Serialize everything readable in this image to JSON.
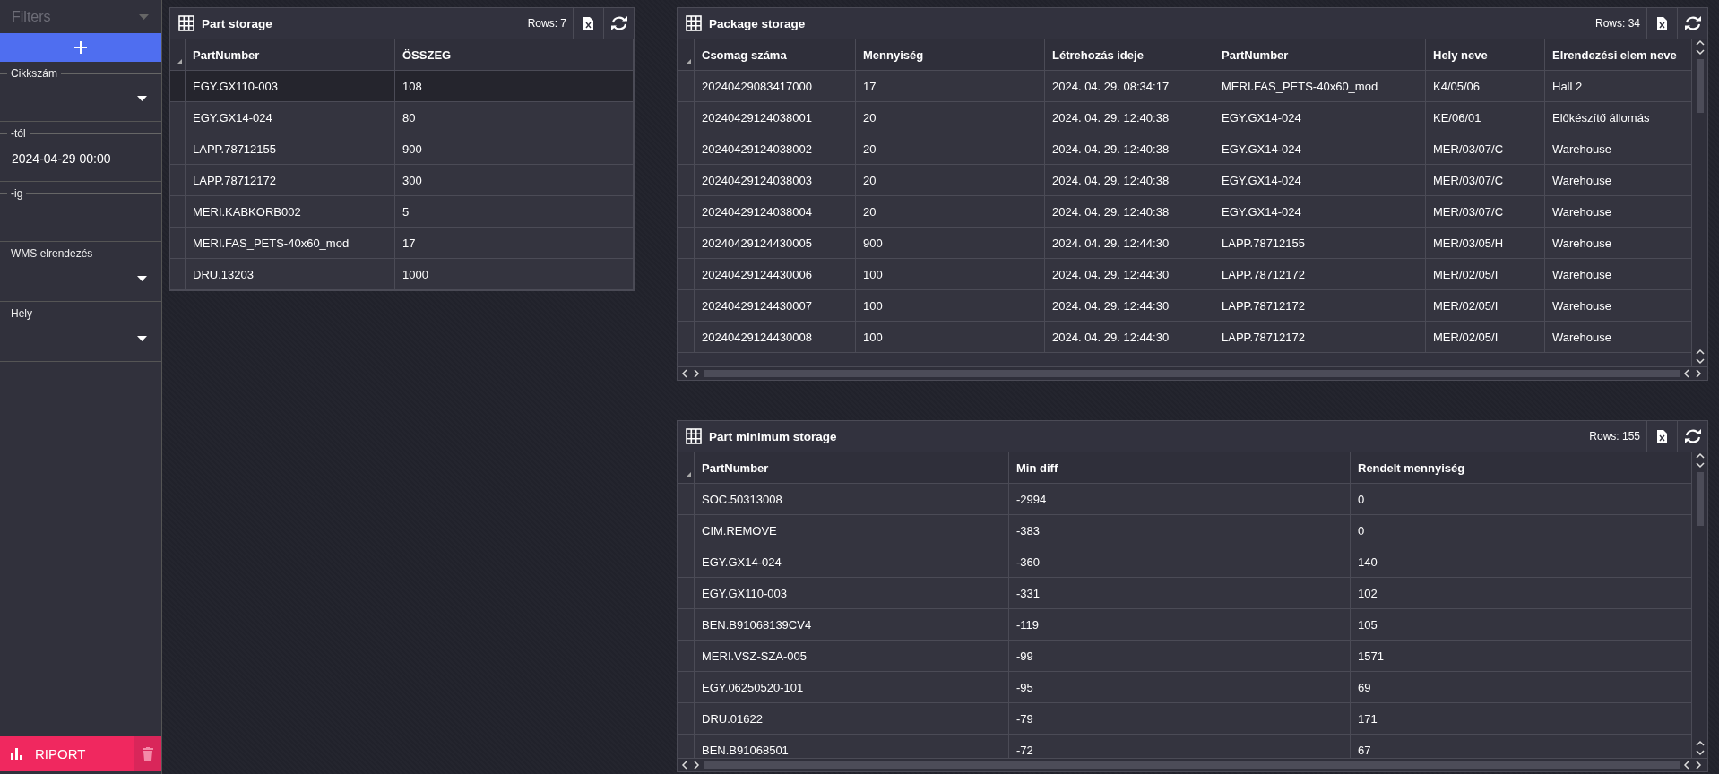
{
  "sidebar": {
    "title": "Filters",
    "filters": [
      {
        "kind": "select",
        "label": "Cikkszám"
      },
      {
        "kind": "date",
        "label": "-tól",
        "value": "2024-04-29 00:00"
      },
      {
        "kind": "date",
        "label": "-ig"
      },
      {
        "kind": "select",
        "label": "WMS elrendezés"
      },
      {
        "kind": "select",
        "label": "Hely"
      }
    ],
    "report_button": "RIPORT"
  },
  "panels": [
    {
      "title": "Part storage",
      "rows_count": "Rows: 7",
      "columns": [
        "PartNumber",
        "ÖSSZEG"
      ],
      "rows": [
        {
          "selected": true,
          "cells": [
            "EGY.GX110-003",
            "108"
          ]
        },
        {
          "selected": false,
          "cells": [
            "EGY.GX14-024",
            "80"
          ]
        },
        {
          "selected": false,
          "cells": [
            "LAPP.78712155",
            "900"
          ]
        },
        {
          "selected": false,
          "cells": [
            "LAPP.78712172",
            "300"
          ]
        },
        {
          "selected": false,
          "cells": [
            "MERI.KABKORB002",
            "5"
          ]
        },
        {
          "selected": false,
          "cells": [
            "MERI.FAS_PETS-40x60_mod",
            "17"
          ]
        },
        {
          "selected": false,
          "cells": [
            "DRU.13203",
            "1000"
          ]
        }
      ]
    },
    {
      "title": "Package storage",
      "rows_count": "Rows: 34",
      "columns": [
        "Csomag száma",
        "Mennyiség",
        "Létrehozás ideje",
        "PartNumber",
        "Hely neve",
        "Elrendezési elem neve"
      ],
      "rows": [
        {
          "cells": [
            "20240429083417000",
            "17",
            "2024. 04. 29. 08:34:17",
            "MERI.FAS_PETS-40x60_mod",
            "K4/05/06",
            "Hall 2"
          ]
        },
        {
          "cells": [
            "20240429124038001",
            "20",
            "2024. 04. 29. 12:40:38",
            "EGY.GX14-024",
            "KE/06/01",
            "Előkészítő állomás"
          ]
        },
        {
          "cells": [
            "20240429124038002",
            "20",
            "2024. 04. 29. 12:40:38",
            "EGY.GX14-024",
            "MER/03/07/C",
            "Warehouse"
          ]
        },
        {
          "cells": [
            "20240429124038003",
            "20",
            "2024. 04. 29. 12:40:38",
            "EGY.GX14-024",
            "MER/03/07/C",
            "Warehouse"
          ]
        },
        {
          "cells": [
            "20240429124038004",
            "20",
            "2024. 04. 29. 12:40:38",
            "EGY.GX14-024",
            "MER/03/07/C",
            "Warehouse"
          ]
        },
        {
          "cells": [
            "20240429124430005",
            "900",
            "2024. 04. 29. 12:44:30",
            "LAPP.78712155",
            "MER/03/05/H",
            "Warehouse"
          ]
        },
        {
          "cells": [
            "20240429124430006",
            "100",
            "2024. 04. 29. 12:44:30",
            "LAPP.78712172",
            "MER/02/05/I",
            "Warehouse"
          ]
        },
        {
          "cells": [
            "20240429124430007",
            "100",
            "2024. 04. 29. 12:44:30",
            "LAPP.78712172",
            "MER/02/05/I",
            "Warehouse"
          ]
        },
        {
          "cells": [
            "20240429124430008",
            "100",
            "2024. 04. 29. 12:44:30",
            "LAPP.78712172",
            "MER/02/05/I",
            "Warehouse"
          ]
        }
      ]
    },
    {
      "title": "Part minimum storage",
      "rows_count": "Rows: 155",
      "columns": [
        "PartNumber",
        "Min diff",
        "Rendelt mennyiség"
      ],
      "rows": [
        {
          "cells": [
            "SOC.50313008",
            "-2994",
            "0"
          ]
        },
        {
          "cells": [
            "CIM.REMOVE",
            "-383",
            "0"
          ]
        },
        {
          "cells": [
            "EGY.GX14-024",
            "-360",
            "140"
          ]
        },
        {
          "cells": [
            "EGY.GX110-003",
            "-331",
            "102"
          ]
        },
        {
          "cells": [
            "BEN.B91068139CV4",
            "-119",
            "105"
          ]
        },
        {
          "cells": [
            "MERI.VSZ-SZA-005",
            "-99",
            "1571"
          ]
        },
        {
          "cells": [
            "EGY.06250520-101",
            "-95",
            "69"
          ]
        },
        {
          "cells": [
            "DRU.01622",
            "-79",
            "171"
          ]
        },
        {
          "cells": [
            "BEN.B91068501",
            "-72",
            "67"
          ]
        }
      ]
    }
  ]
}
